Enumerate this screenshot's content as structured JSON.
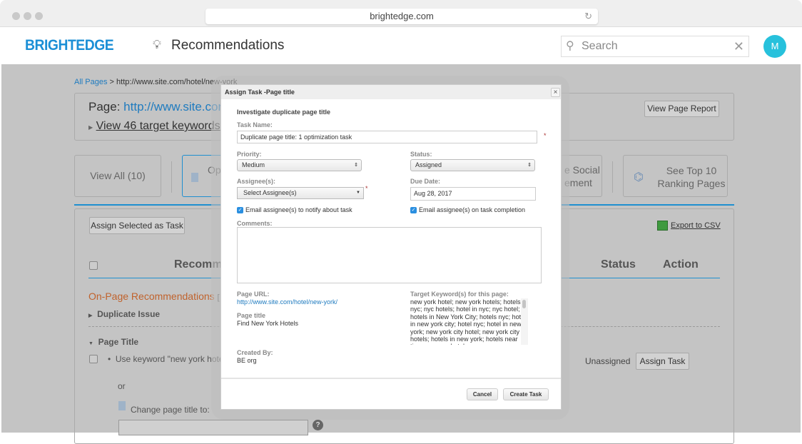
{
  "browser": {
    "url": "brightedge.com",
    "reload_icon": "reload-icon"
  },
  "app": {
    "logo": "BRIGHTEDGE",
    "title": "Recommendations",
    "title_icon": "lightbulb-icon",
    "search_placeholder": "Search",
    "avatar_initial": "M"
  },
  "background": {
    "breadcrumb_root": "All Pages",
    "breadcrumb_sep": ">",
    "breadcrumb_current": "http://www.site.com/hotel/new-york",
    "page_label": "Page:",
    "page_url": "http://www.site.com/",
    "view_keywords": "View 46 target keywords",
    "view_page_report": "View Page Report",
    "tabs": [
      {
        "label": "View All (10)"
      },
      {
        "label": "Op"
      },
      {
        "label": "e Social\nement"
      },
      {
        "label": "See Top 10\nRanking Pages"
      }
    ],
    "assign_selected": "Assign Selected as Task",
    "export_csv": "Export to CSV",
    "col_recomm": "Recomm",
    "col_status": "Status",
    "col_action": "Action",
    "section": "On-Page Recommendations",
    "section_bracket": "[",
    "duplicate_issue": "Duplicate Issue",
    "page_title_group": "Page Title",
    "keyword_rec": "Use keyword \"new york hote",
    "unassigned": "Unassigned",
    "assign_task": "Assign Task",
    "or": "or",
    "change_title": "Change page title to:",
    "help": "?"
  },
  "modal": {
    "title": "Assign Task -Page title",
    "close": "×",
    "heading": "Investigate duplicate page title",
    "task_name_label": "Task Name:",
    "task_name_value": "Duplicate page title: 1 optimization task",
    "required": "*",
    "priority_label": "Priority:",
    "priority_value": "Medium",
    "status_label": "Status:",
    "status_value": "Assigned",
    "assignee_label": "Assignee(s):",
    "assignee_value": "Select Assignee(s)",
    "due_label": "Due Date:",
    "due_value": "Aug 28, 2017",
    "email_notify": "Email assignee(s) to notify about task",
    "email_notify_checked": true,
    "email_complete": "Email assignee(s) on task completion",
    "email_complete_checked": true,
    "comments_label": "Comments:",
    "comments_value": "",
    "page_url_label": "Page URL:",
    "page_url": "http://www.site.com/hotel/new-york/",
    "page_title_label": "Page title",
    "page_title": "Find New York Hotels",
    "created_by_label": "Created By:",
    "created_by": "BE org",
    "keywords_label": "Target Keyword(s) for this page:",
    "keywords": "new york hotel; new york hotels; hotels in nyc; nyc hotels; hotel in nyc; nyc hotel; hotels in New York City; hotels nyc; hotel in new york city; hotel nyc; hotel in new york; new york city hotel; new york city hotels; hotels in new york; hotels near times square; hotels",
    "cancel": "Cancel",
    "create": "Create Task"
  },
  "colors": {
    "brand": "#1b8fd6",
    "avatar": "#27c1dc",
    "section": "#c0622c",
    "checkbox": "#2a8fe0"
  }
}
